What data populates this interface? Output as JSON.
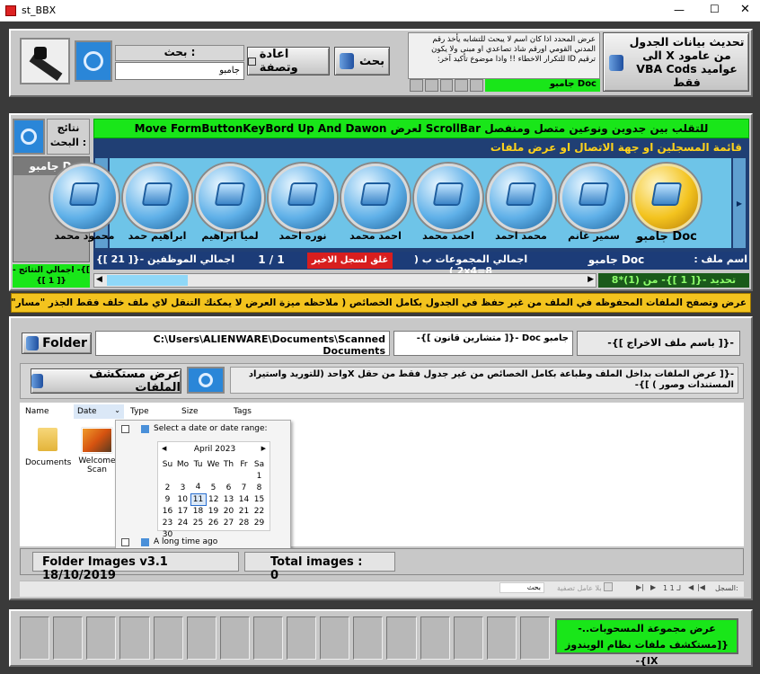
{
  "window": {
    "title": "st_BBX",
    "minimize": "—",
    "maximize": "☐",
    "close": "✕"
  },
  "top": {
    "update_button": "تحديث بيانات الجدول من عامود X الى عواميد VBA Cods فقط",
    "info_text": "عرض المحدد اذا كان اسم لا يبحث للتشابه يأخذ رقم المدني القومي اورقم شاذ تصاعدي او مبنى ولا يكون ترقيم ID للتكرار الاخطاء !! واذا موضوع تأكيد آخر:",
    "info_value": "جامبو Doc",
    "search_button": "بحث",
    "reset_button": "اعادة وتصفة",
    "search_label": "بحث :",
    "search_value": "جامبو"
  },
  "results_panel": {
    "label": "نتائج البحث :",
    "first_result": "جامبو Doc",
    "total_results": "]}- اجمالي النتائج -{[ 1 ]}"
  },
  "banner": "للتقلب بين جدوين ونوعين متصل ومنفصل ScrollBar لعرض Move FormButtonKeyBord Up And Dawon",
  "list_header": "قائمة المسجلين او جهة الاتصال او عرض ملفات",
  "people": [
    {
      "name": "جامبو Doc",
      "selected": true
    },
    {
      "name": "سمير غانم",
      "selected": false
    },
    {
      "name": "محمد احمد",
      "selected": false
    },
    {
      "name": "احمد محمد",
      "selected": false
    },
    {
      "name": "احمد محمد",
      "selected": false
    },
    {
      "name": "نوره احمد",
      "selected": false
    },
    {
      "name": "لميا ابراهيم",
      "selected": false
    },
    {
      "name": "ابراهيم حمد",
      "selected": false
    },
    {
      "name": "محمود محمد",
      "selected": false
    }
  ],
  "status_row": {
    "file_label": "اسم ملف :",
    "file_value": "جامبو Doc",
    "groups": "اجمالي المجموعات ب ( 2x4=8 )",
    "lock_button": "غلق لسجل الاخير",
    "page": "1 / 1",
    "employees": "اجمالي الموظفين -{[ 21 ]}"
  },
  "selection": "تحديد -{[ 1 ]}- من (1)*8",
  "notice": "عرض وتصفح الملفات المحفوظه في الملف من غير حفظ في الجدول بكامل الخصائص ( ملاحظه ميزة العرض لا يمكنك التنقل لاي ملف خلف فقط الجذر \"مسار\" المحدد )_ScrollBar",
  "explorer": {
    "folder_button": "Folder",
    "path": "C:\\Users\\ALIENWARE\\Documents\\Scanned Documents",
    "sub_value": "جامبو Doc -{[ متشارين قانون ]}-",
    "output_label": "-{[ باسم ملف الاخراج ]}-",
    "open_explorer_button": "عرض مستكشف الملفات",
    "hint": "-{[ عرض الملفات بداخل الملف وطباعة بكامل الخصائص من غير جدول فقط من حقل Xواحد (للتوريد واستيراد المستندات وصور ) ]}-",
    "columns": [
      "Name",
      "Date",
      "Type",
      "Size",
      "Tags"
    ],
    "files": [
      {
        "name": "Documents"
      },
      {
        "name": "Welcome Scan"
      }
    ],
    "date_popup": {
      "option1": "Select a date or date range:",
      "month": "April 2023",
      "weekdays": [
        "Su",
        "Mo",
        "Tu",
        "We",
        "Th",
        "Fr",
        "Sa"
      ],
      "weeks": [
        [
          "",
          "",
          "",
          "",
          "",
          "",
          "1"
        ],
        [
          "2",
          "3",
          "4",
          "5",
          "6",
          "7",
          "8"
        ],
        [
          "9",
          "10",
          "11",
          "12",
          "13",
          "14",
          "15"
        ],
        [
          "16",
          "17",
          "18",
          "19",
          "20",
          "21",
          "22"
        ],
        [
          "23",
          "24",
          "25",
          "26",
          "27",
          "28",
          "29"
        ],
        [
          "30",
          "",
          "",
          "",
          "",
          "",
          ""
        ]
      ],
      "today": "11",
      "option2": "A long time ago"
    }
  },
  "footer_info": {
    "version": "Folder Images v3.1  18/10/2019",
    "total": "Total images : 0"
  },
  "nav": {
    "record_label": "السجل:",
    "record_value": "1 لـ 1",
    "filter": "بلا عامل تصفية",
    "search": "بحث"
  },
  "bottom": {
    "group_button": "عرض مجموعة المسحوبات..-{[مستكشف ملفات نظام الويندوز IX}-"
  },
  "colors": {
    "green": "#19e619",
    "navy": "#1c3c78",
    "yellow": "#f3c31e"
  }
}
